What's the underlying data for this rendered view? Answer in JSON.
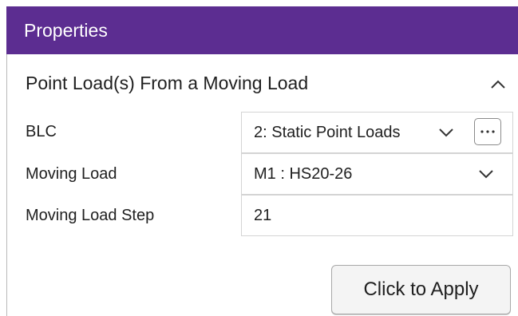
{
  "panel": {
    "title": "Properties"
  },
  "section": {
    "title": "Point Load(s) From a Moving Load",
    "collapse_icon": "chevron-up-icon"
  },
  "fields": {
    "blc": {
      "label": "BLC",
      "value": "2: Static Point Loads",
      "dropdown_icon": "chevron-down-icon",
      "more_icon": "ellipsis-icon"
    },
    "moving_load": {
      "label": "Moving Load",
      "value": "M1 : HS20-26",
      "dropdown_icon": "chevron-down-icon"
    },
    "moving_load_step": {
      "label": "Moving Load Step",
      "value": "21"
    }
  },
  "actions": {
    "apply_label": "Click to Apply"
  },
  "colors": {
    "header_bg": "#5c2d91",
    "header_text": "#ffffff"
  }
}
